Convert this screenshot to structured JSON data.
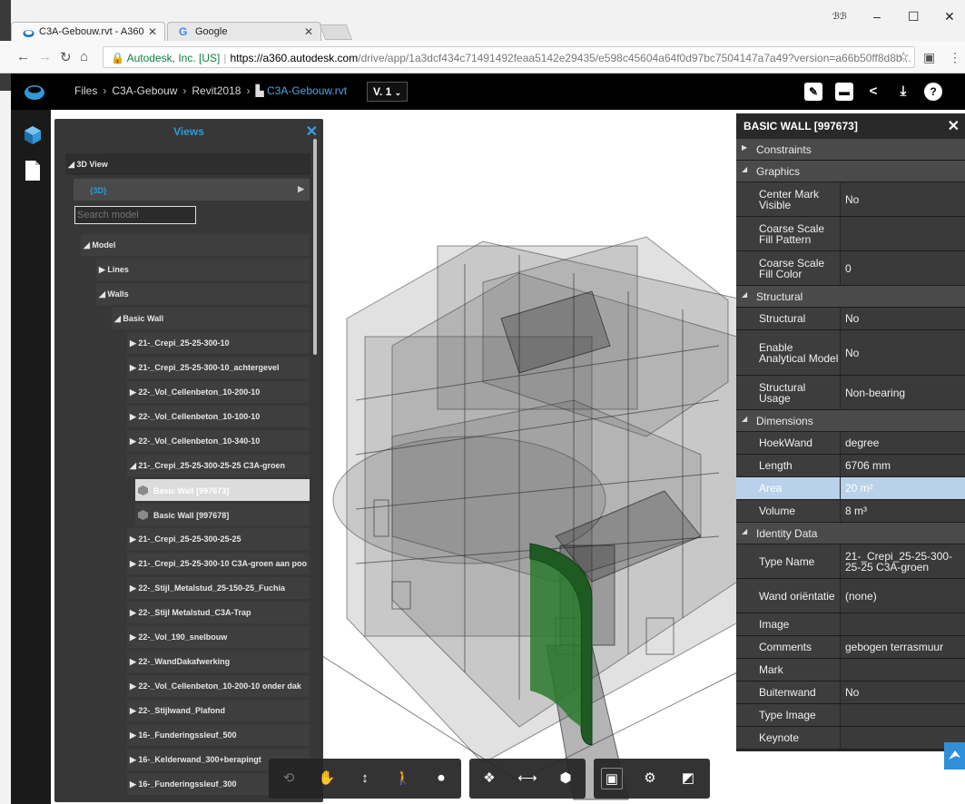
{
  "browser": {
    "tabs": [
      {
        "title": "C3A-Gebouw.rvt - A360",
        "active": true
      },
      {
        "title": "Google",
        "active": false
      }
    ],
    "profile": "ℬℬ",
    "window_controls": {
      "minimize": "–",
      "maximize": "☐",
      "close": "✕"
    },
    "address": {
      "secure_label": "Autodesk, Inc. [US]",
      "scheme_host": "https://a360.autodesk.com",
      "path": "/drive/app/1a3dcf434c71491492feaa5142e29435/e598c45604a64f0d97bc7504147a7a49?version=a66b50ff8d8b..."
    }
  },
  "header": {
    "breadcrumb": [
      "Files",
      "C3A-Gebouw",
      "Revit2018"
    ],
    "current_file": "C3A-Gebouw.rvt",
    "version": "V. 1"
  },
  "views_panel": {
    "title": "Views",
    "section_3d": "3D View",
    "view_3d": "{3D}",
    "search_placeholder": "Search model",
    "tree": {
      "model": "Model",
      "lines": "Lines",
      "walls": "Walls",
      "basic_wall": "Basic Wall",
      "types": [
        "21-_Crepi_25-25-300-10",
        "21-_Crepi_25-25-300-10_achtergevel",
        "22-_Vol_Cellenbeton_10-200-10",
        "22-_Vol_Cellenbeton_10-100-10",
        "22-_Vol_Cellenbeton_10-340-10",
        "21-_Crepi_25-25-300-25-25 C3A-groen"
      ],
      "instances": [
        "Basic Wall [997673]",
        "Basic Wall [997678]"
      ],
      "more_types": [
        "21-_Crepi_25-25-300-25-25",
        "21-_Crepi_25-25-300-10 C3A-groen aan poo",
        "22-_Stijl_Metalstud_25-150-25_Fuchia",
        "22-_Stijl Metalstud_C3A-Trap",
        "22-_Vol_190_snelbouw",
        "22-_WandDakafwerking",
        "22-_Vol_Cellenbeton_10-200-10 onder dak",
        "22-_Stijlwand_Plafond",
        "16-_Funderingssleuf_500",
        "16-_Kelderwand_300+berapingt",
        "16-_Funderingssleuf_300"
      ]
    }
  },
  "properties": {
    "title": "BASIC WALL [997673]",
    "rows": [
      {
        "kind": "cat",
        "expanded": false,
        "label": "Constraints"
      },
      {
        "kind": "cat",
        "expanded": true,
        "label": "Graphics"
      },
      {
        "kind": "prop",
        "key": "Center Mark Visible",
        "value": "No",
        "lines": 2
      },
      {
        "kind": "prop",
        "key": "Coarse Scale Fill Pattern",
        "value": "",
        "lines": 2
      },
      {
        "kind": "prop",
        "key": "Coarse Scale Fill Color",
        "value": "0",
        "lines": 2
      },
      {
        "kind": "cat",
        "expanded": true,
        "label": "Structural"
      },
      {
        "kind": "prop",
        "key": "Structural",
        "value": "No",
        "lines": 1
      },
      {
        "kind": "prop",
        "key": "Enable Analytical Model",
        "value": "No",
        "lines": 3
      },
      {
        "kind": "prop",
        "key": "Structural Usage",
        "value": "Non-bearing",
        "lines": 2
      },
      {
        "kind": "cat",
        "expanded": true,
        "label": "Dimensions"
      },
      {
        "kind": "prop",
        "key": "HoekWand",
        "value": "degree",
        "lines": 1
      },
      {
        "kind": "prop",
        "key": "Length",
        "value": "6706 mm",
        "lines": 1
      },
      {
        "kind": "prop",
        "key": "Area",
        "value": "20 m²",
        "lines": 1,
        "highlight": true
      },
      {
        "kind": "prop",
        "key": "Volume",
        "value": "8 m³",
        "lines": 1
      },
      {
        "kind": "cat",
        "expanded": true,
        "label": "Identity Data"
      },
      {
        "kind": "prop",
        "key": "Type Name",
        "value": "21-_Crepi_25-25-300-25-25 C3A-groen",
        "lines": 2
      },
      {
        "kind": "prop",
        "key": "Wand oriëntatie",
        "value": "(none)",
        "lines": 2
      },
      {
        "kind": "prop",
        "key": "Image",
        "value": "",
        "lines": 1
      },
      {
        "kind": "prop",
        "key": "Comments",
        "value": "gebogen terrasmuur",
        "lines": 1
      },
      {
        "kind": "prop",
        "key": "Mark",
        "value": "",
        "lines": 1
      },
      {
        "kind": "prop",
        "key": "Buitenwand",
        "value": "No",
        "lines": 1
      },
      {
        "kind": "prop",
        "key": "Type Image",
        "value": "",
        "lines": 1
      },
      {
        "kind": "prop",
        "key": "Keynote",
        "value": "",
        "lines": 1
      }
    ]
  },
  "toolbar": {
    "buttons": [
      "orbit-icon",
      "pan-icon",
      "zoom-icon",
      "first-person-icon",
      "camera-icon",
      "explode-icon",
      "measure-icon",
      "section-icon",
      "model-browser-icon",
      "settings-icon",
      "fullscreen-icon"
    ]
  },
  "colors": {
    "accent": "#2f9ad8",
    "selected_wall": "#1f5a22",
    "highlight_row": "#b9d1ea"
  }
}
